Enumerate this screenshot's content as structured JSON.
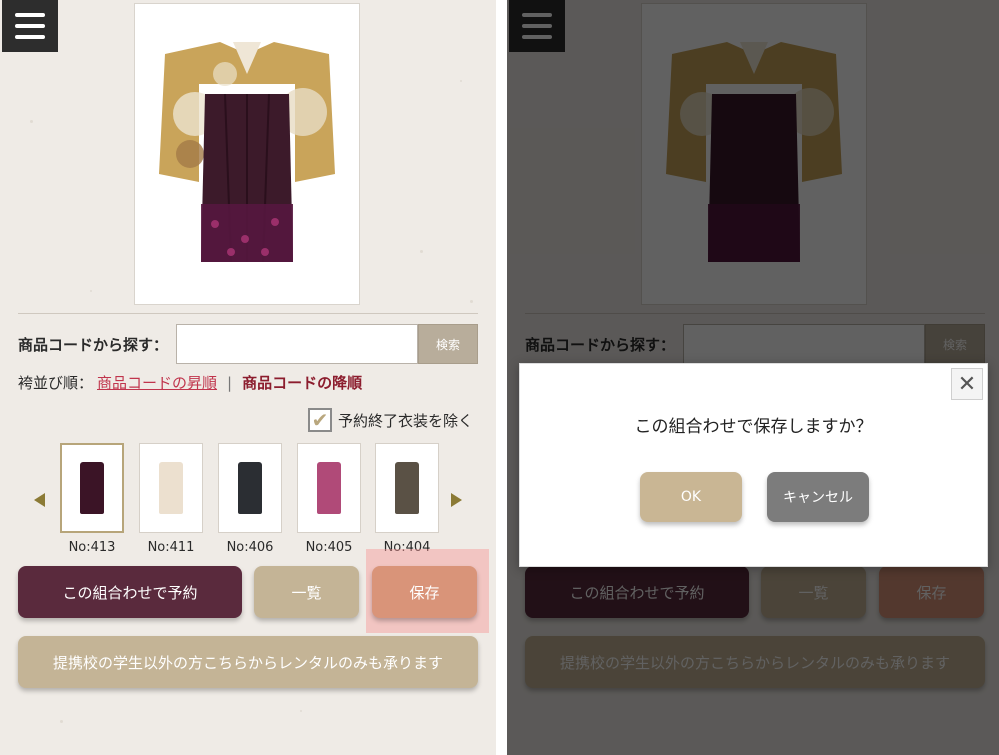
{
  "search": {
    "label": "商品コードから探す：",
    "button_label": "検索",
    "value": ""
  },
  "sort": {
    "label": "袴並び順：",
    "asc_label": "商品コードの昇順",
    "separator": "|",
    "desc_label": "商品コードの降順"
  },
  "filter": {
    "exclude_label": "予約終了衣装を除く",
    "checked": true
  },
  "thumbnails": [
    {
      "label": "No:413",
      "color": "#3b1426"
    },
    {
      "label": "No:411",
      "color": "#ece0cf"
    },
    {
      "label": "No:406",
      "color": "#2b2e33"
    },
    {
      "label": "No:405",
      "color": "#b04a78"
    },
    {
      "label": "No:404",
      "color": "#5a5145"
    }
  ],
  "buttons": {
    "reserve": "この組合わせで予約",
    "list": "一覧",
    "save": "保存",
    "rental": "提携校の学生以外の方こちらからレンタルのみも承ります"
  },
  "dialog": {
    "message": "この組合わせで保存しますか？",
    "ok": "OK",
    "cancel": "キャンセル",
    "close_icon": "close-icon"
  },
  "colors": {
    "reserve": "#5a2a3d",
    "beige": "#c4b496",
    "save": "#d99479",
    "link": "#c0344c"
  }
}
